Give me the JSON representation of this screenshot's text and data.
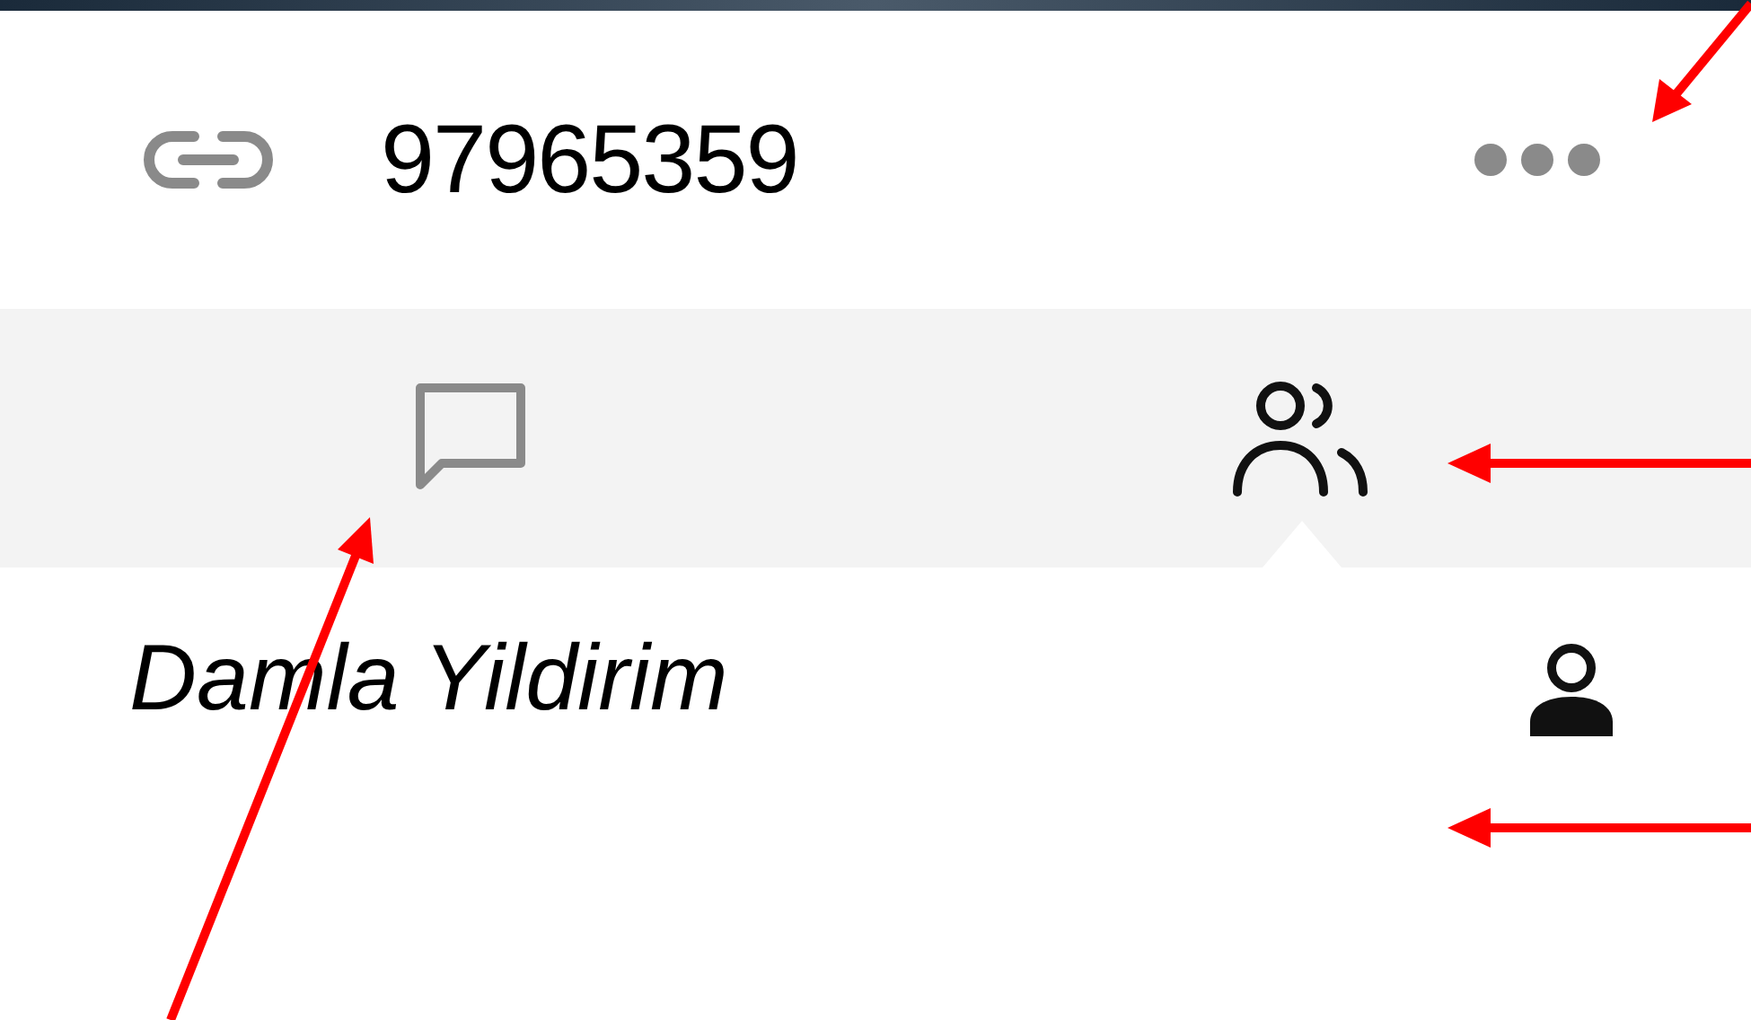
{
  "conversation": {
    "id": "97965359"
  },
  "tabs": [
    {
      "kind": "chat",
      "selected": false
    },
    {
      "kind": "people",
      "selected": true
    }
  ],
  "participants": [
    {
      "name": "Damla Yildirim"
    }
  ]
}
